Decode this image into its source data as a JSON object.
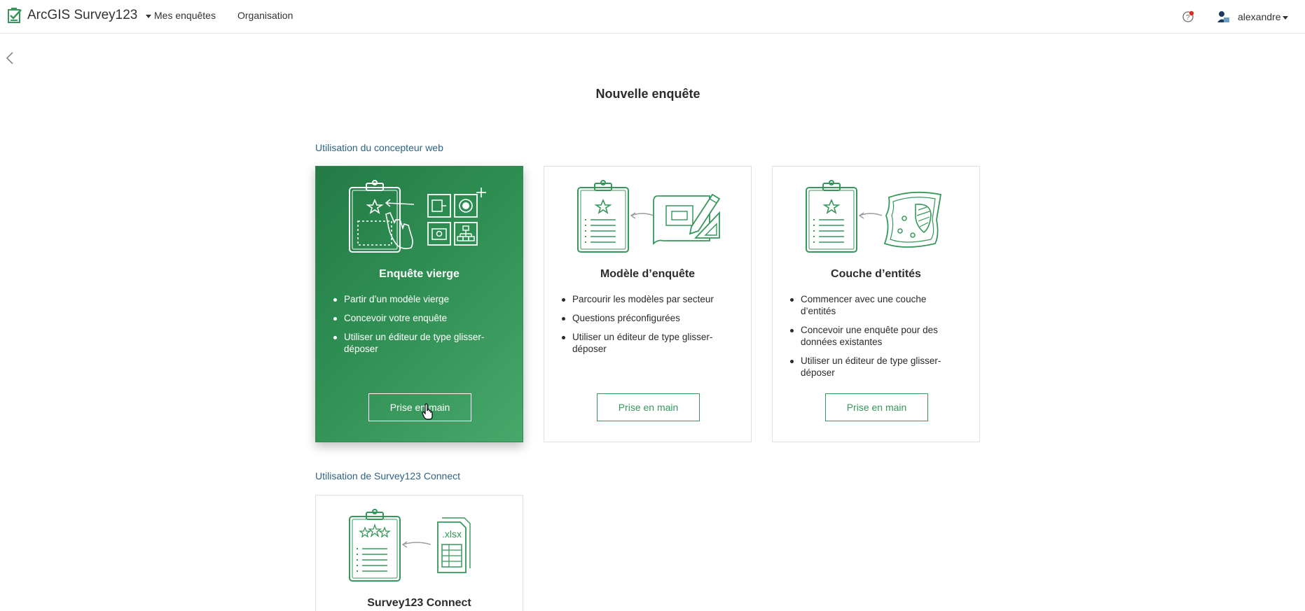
{
  "header": {
    "app_name": "ArcGIS Survey123",
    "nav": [
      "Mes enquêtes",
      "Organisation"
    ],
    "user_name": "alexandre",
    "brand_color": "#35975a"
  },
  "page": {
    "title": "Nouvelle enquête"
  },
  "sections": {
    "web_designer": "Utilisation du concepteur web",
    "connect": "Utilisation de Survey123 Connect"
  },
  "cards": [
    {
      "title": "Enquête vierge",
      "bullets": [
        "Partir d’un modèle vierge",
        "Concevoir votre enquête",
        "Utiliser un éditeur de type glisser-déposer"
      ],
      "button": "Prise en main",
      "selected": true
    },
    {
      "title": "Modèle d’enquête",
      "bullets": [
        "Parcourir les modèles par secteur",
        "Questions préconfigurées",
        "Utiliser un éditeur de type glisser-déposer"
      ],
      "button": "Prise en main",
      "selected": false
    },
    {
      "title": "Couche d’entités",
      "bullets": [
        "Commencer avec une couche d’entités",
        "Concevoir une enquête pour des données existantes",
        "Utiliser un éditeur de type glisser-déposer"
      ],
      "button": "Prise en main",
      "selected": false
    },
    {
      "title": "Survey123 Connect",
      "file_label": ".xlsx"
    }
  ],
  "icons": {
    "logo": "survey123-logo-icon",
    "help": "help-notification-icon",
    "avatar": "user-avatar-icon",
    "back": "chevron-left-icon"
  }
}
